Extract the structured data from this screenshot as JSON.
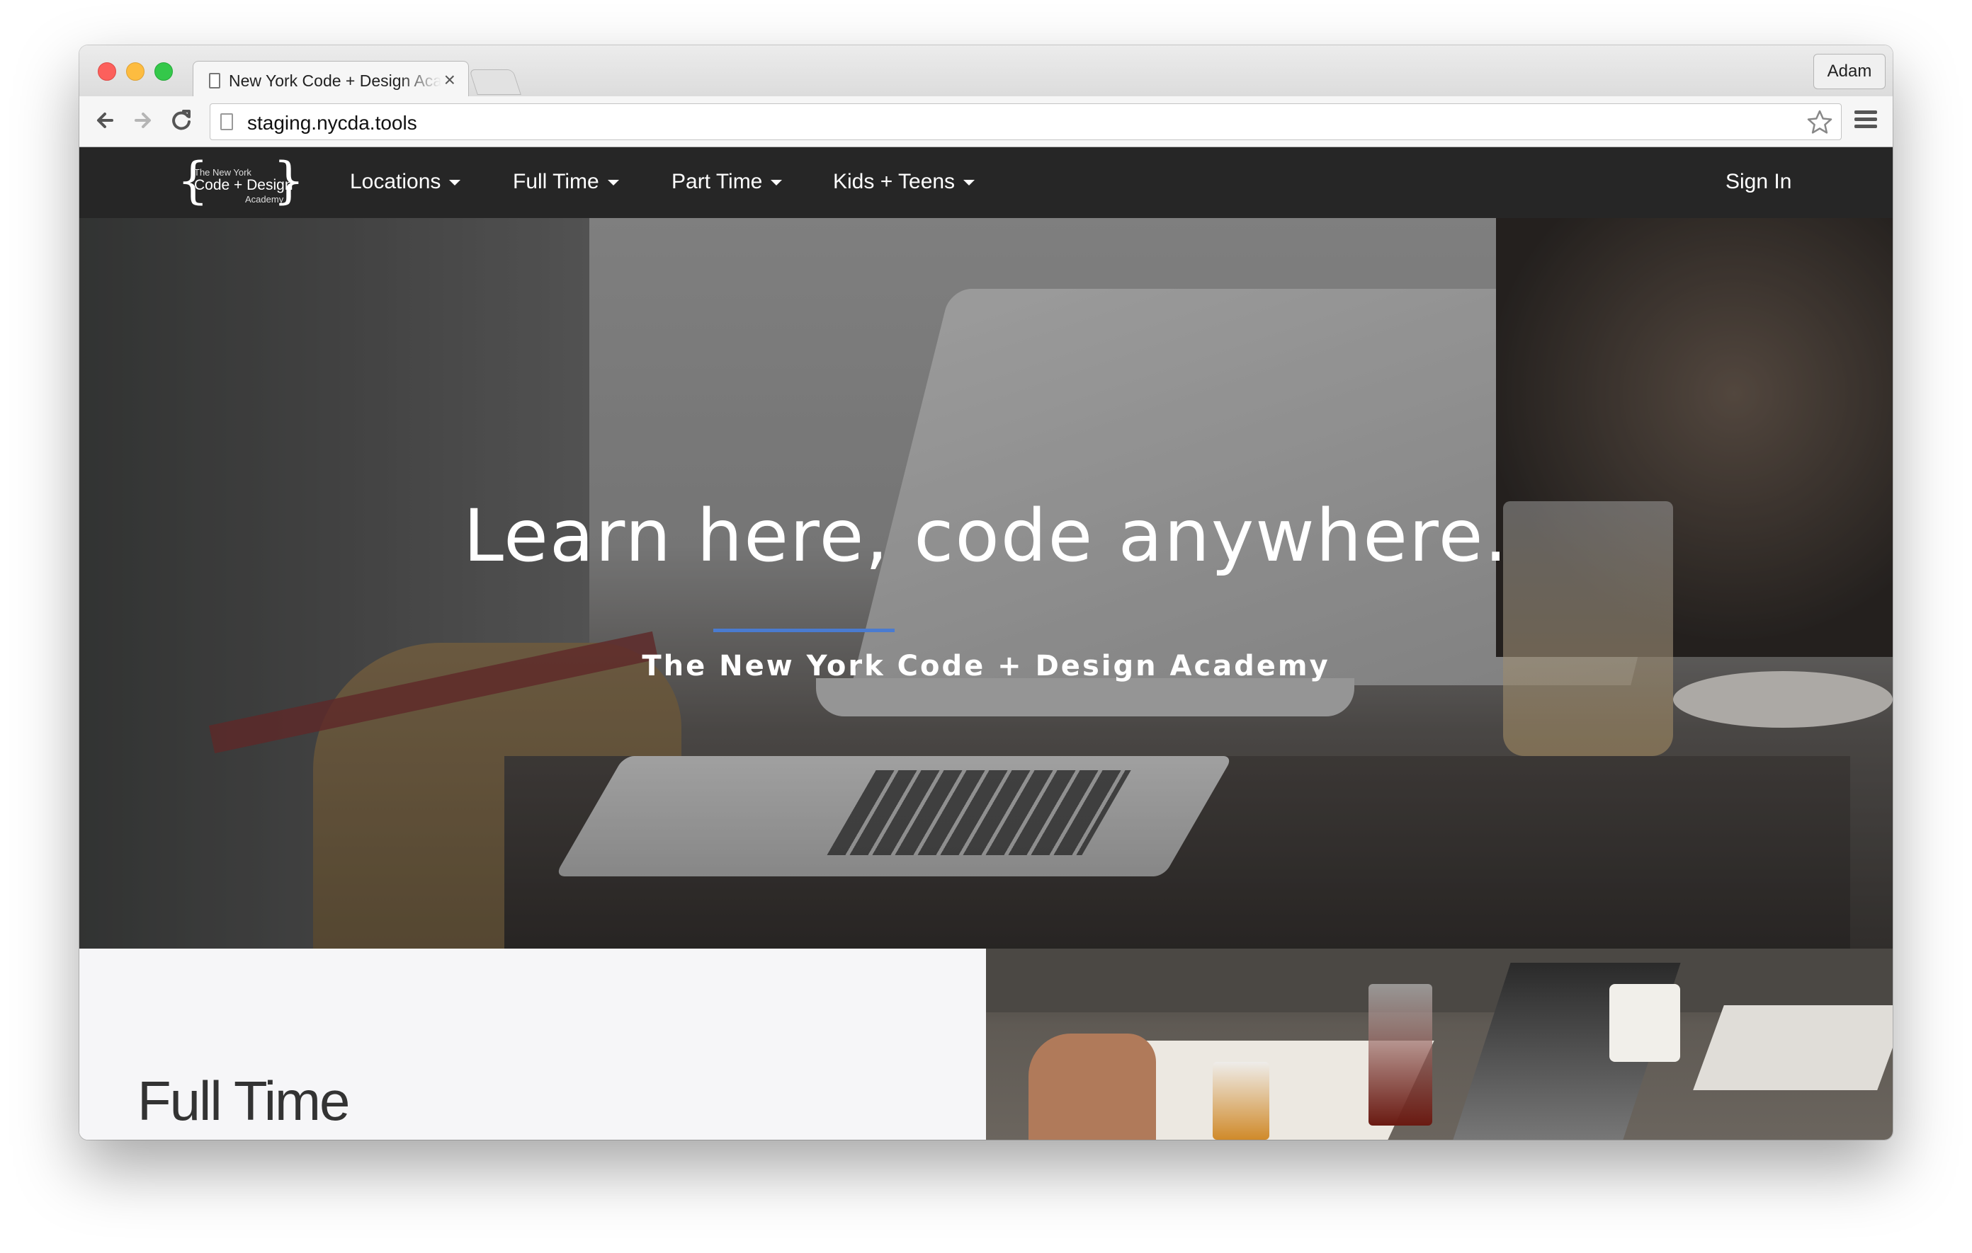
{
  "browser": {
    "tab_title": "New York Code + Design Academy",
    "tab_close": "×",
    "profile_name": "Adam",
    "url": "staging.nycda.tools"
  },
  "navbar": {
    "logo": {
      "line_small": "The New York",
      "line_main": "Code + Design",
      "line_sub": "Academy"
    },
    "items": [
      {
        "label": "Locations",
        "has_dropdown": true
      },
      {
        "label": "Full Time",
        "has_dropdown": true
      },
      {
        "label": "Part Time",
        "has_dropdown": true
      },
      {
        "label": "Kids + Teens",
        "has_dropdown": true
      }
    ],
    "sign_in": "Sign In"
  },
  "hero": {
    "title": "Learn here, code anywhere.",
    "subtitle": "The New York Code + Design Academy",
    "accent_color": "#4a7bd0"
  },
  "sections": {
    "first_title": "Full Time"
  },
  "colors": {
    "navbar_bg": "#262626",
    "page_bg": "#f6f6f8"
  }
}
